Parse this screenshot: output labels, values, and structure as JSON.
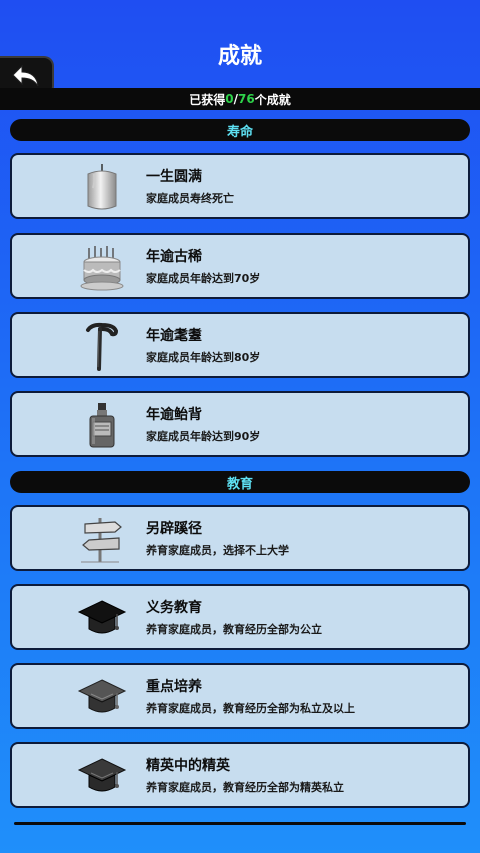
{
  "header": {
    "title": "成就"
  },
  "back_button": {
    "icon": "back-arrow-icon"
  },
  "progress": {
    "prefix": "已获得",
    "earned": "0",
    "separator": "/",
    "total": "76",
    "suffix": "个成就"
  },
  "sections": [
    {
      "name": "寿命",
      "items": [
        {
          "title": "一生圆满",
          "desc": "家庭成员寿终死亡",
          "icon": "candle-icon"
        },
        {
          "title": "年逾古稀",
          "desc": "家庭成员年龄达到70岁",
          "icon": "birthday-cake-icon"
        },
        {
          "title": "年逾耄耋",
          "desc": "家庭成员年龄达到80岁",
          "icon": "walking-cane-icon"
        },
        {
          "title": "年逾鲐背",
          "desc": "家庭成员年龄达到90岁",
          "icon": "bottle-icon"
        }
      ]
    },
    {
      "name": "教育",
      "items": [
        {
          "title": "另辟蹊径",
          "desc": "养育家庭成员，选择不上大学",
          "icon": "signpost-icon"
        },
        {
          "title": "义务教育",
          "desc": "养育家庭成员，教育经历全部为公立",
          "icon": "graduation-cap-icon"
        },
        {
          "title": "重点培养",
          "desc": "养育家庭成员，教育经历全部为私立及以上",
          "icon": "graduation-cap-icon"
        },
        {
          "title": "精英中的精英",
          "desc": "养育家庭成员，教育经历全部为精英私立",
          "icon": "graduation-cap-icon"
        }
      ]
    }
  ]
}
